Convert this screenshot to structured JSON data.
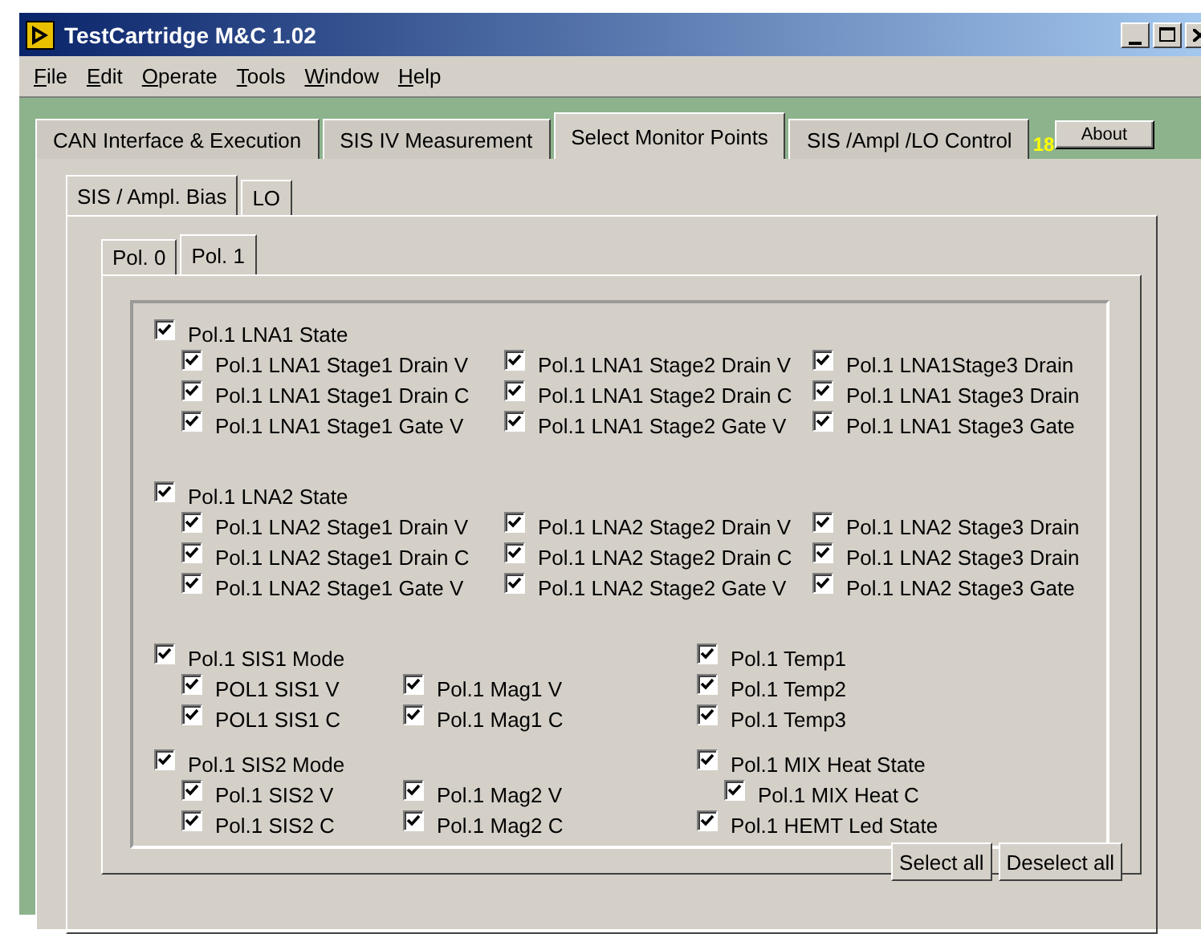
{
  "window": {
    "title": "TestCartridge M&C 1.02"
  },
  "menu": [
    "File",
    "Edit",
    "Operate",
    "Tools",
    "Window",
    "Help"
  ],
  "tabs": [
    {
      "label": "CAN Interface & Execution",
      "selected": false
    },
    {
      "label": "SIS IV Measurement",
      "selected": false
    },
    {
      "label": "Select Monitor Points",
      "selected": true
    },
    {
      "label": "SIS /Ampl /LO Control",
      "selected": false
    }
  ],
  "indicator": "18",
  "about_button": "About",
  "sub_tabs": [
    {
      "label": "SIS / Ampl. Bias",
      "selected": true
    },
    {
      "label": "LO",
      "selected": false
    }
  ],
  "pol_tabs": [
    {
      "label": "Pol. 0",
      "selected": false
    },
    {
      "label": "Pol. 1",
      "selected": true
    }
  ],
  "lna_blocks": [
    {
      "label": "Pol.1 LNA1 State",
      "checked": true,
      "children": [
        {
          "label": "Pol.1 LNA1 Stage1 Drain V",
          "checked": true
        },
        {
          "label": "Pol.1 LNA1 Stage2 Drain V",
          "checked": true
        },
        {
          "label": "Pol.1 LNA1Stage3 Drain",
          "checked": true
        },
        {
          "label": "Pol.1 LNA1 Stage1 Drain C",
          "checked": true
        },
        {
          "label": "Pol.1 LNA1 Stage2 Drain C",
          "checked": true
        },
        {
          "label": "Pol.1 LNA1 Stage3 Drain",
          "checked": true
        },
        {
          "label": "Pol.1 LNA1 Stage1 Gate V",
          "checked": true
        },
        {
          "label": "Pol.1 LNA1 Stage2 Gate V",
          "checked": true
        },
        {
          "label": "Pol.1 LNA1 Stage3 Gate",
          "checked": true
        }
      ]
    },
    {
      "label": "Pol.1 LNA2 State",
      "checked": true,
      "children": [
        {
          "label": "Pol.1 LNA2 Stage1 Drain V",
          "checked": true
        },
        {
          "label": "Pol.1 LNA2 Stage2 Drain V",
          "checked": true
        },
        {
          "label": "Pol.1 LNA2 Stage3 Drain",
          "checked": true
        },
        {
          "label": "Pol.1 LNA2 Stage1 Drain C",
          "checked": true
        },
        {
          "label": "Pol.1 LNA2 Stage2 Drain C",
          "checked": true
        },
        {
          "label": "Pol.1 LNA2 Stage3 Drain",
          "checked": true
        },
        {
          "label": "Pol.1 LNA2 Stage1 Gate V",
          "checked": true
        },
        {
          "label": "Pol.1 LNA2 Stage2 Gate V",
          "checked": true
        },
        {
          "label": "Pol.1 LNA2 Stage3 Gate",
          "checked": true
        }
      ]
    }
  ],
  "sis_blocks": [
    {
      "label": "Pol.1 SIS1 Mode",
      "checked": true,
      "children": [
        {
          "label": "POL1 SIS1 V",
          "checked": true
        },
        {
          "label": "Pol.1 Mag1 V",
          "checked": true
        },
        {
          "label": "POL1 SIS1 C",
          "checked": true
        },
        {
          "label": "Pol.1 Mag1 C",
          "checked": true
        }
      ]
    },
    {
      "label": "Pol.1 SIS2 Mode",
      "checked": true,
      "children": [
        {
          "label": "Pol.1 SIS2 V",
          "checked": true
        },
        {
          "label": "Pol.1 Mag2 V",
          "checked": true
        },
        {
          "label": "Pol.1 SIS2 C",
          "checked": true
        },
        {
          "label": "Pol.1 Mag2 C",
          "checked": true
        }
      ]
    }
  ],
  "right_column": [
    [
      {
        "label": "Pol.1 Temp1",
        "checked": true
      },
      {
        "label": "Pol.1 Temp2",
        "checked": true
      },
      {
        "label": "Pol.1 Temp3",
        "checked": true
      }
    ],
    [
      {
        "label": "Pol.1 MIX Heat State",
        "checked": true,
        "children": [
          {
            "label": "Pol.1 MIX Heat C",
            "checked": true
          }
        ]
      },
      {
        "label": "Pol.1 HEMT Led State",
        "checked": true
      }
    ]
  ],
  "buttons": [
    "Select all",
    "Deselect all"
  ]
}
